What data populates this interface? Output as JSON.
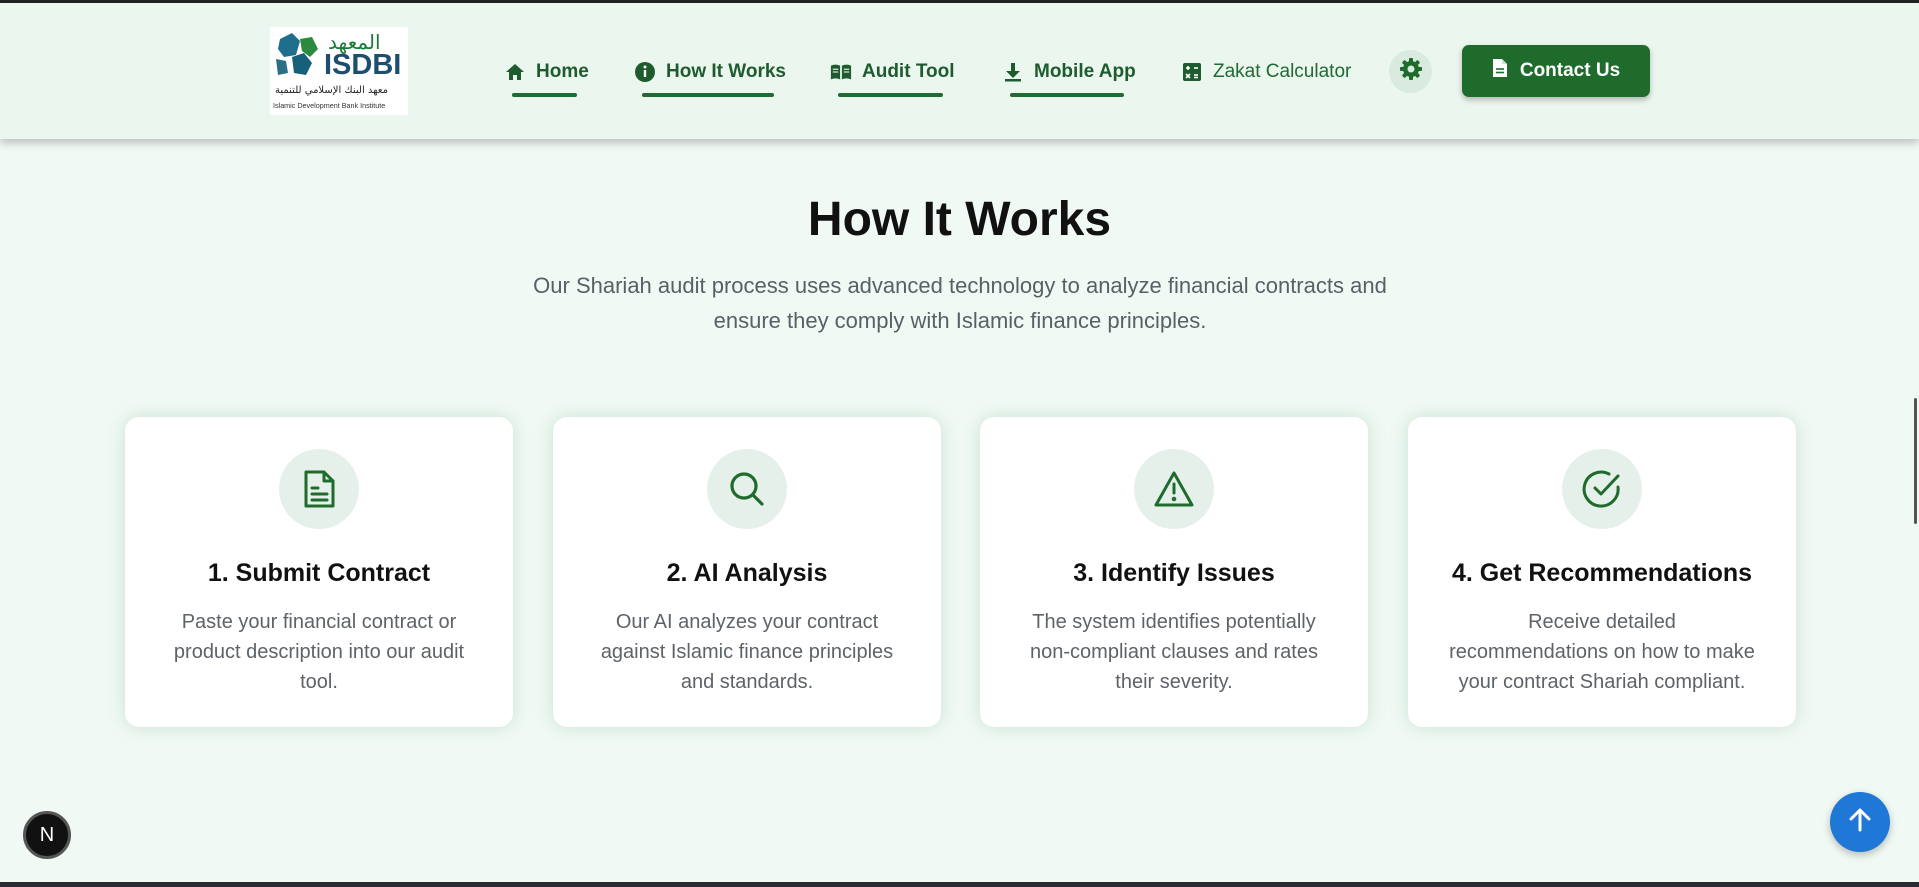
{
  "brand": {
    "arabic_name": "المعهد",
    "short_name": "ISDBI",
    "arabic_full": "معهد البنك الإسلامي للتنمية",
    "english_full": "Islamic Development Bank Institute"
  },
  "nav": {
    "items": [
      {
        "label": "Home",
        "icon": "home-icon",
        "active": true
      },
      {
        "label": "How It Works",
        "icon": "info-icon",
        "active": true
      },
      {
        "label": "Audit Tool",
        "icon": "book-icon",
        "active": true
      },
      {
        "label": "Mobile App",
        "icon": "download-icon",
        "active": true
      },
      {
        "label": "Zakat Calculator",
        "icon": "calculator-icon",
        "active": false
      }
    ],
    "settings_icon": "gear-icon",
    "contact_label": "Contact Us",
    "contact_icon": "document-icon"
  },
  "section": {
    "title": "How It Works",
    "subtitle": "Our Shariah audit process uses advanced technology to analyze financial contracts and ensure they comply with Islamic finance principles."
  },
  "steps": [
    {
      "title": "1. Submit Contract",
      "description": "Paste your financial contract or product description into our audit tool.",
      "icon": "file-text-icon"
    },
    {
      "title": "2. AI Analysis",
      "description": "Our AI analyzes your contract against Islamic finance principles and standards.",
      "icon": "search-icon"
    },
    {
      "title": "3. Identify Issues",
      "description": "The system identifies potentially non-compliant clauses and rates their severity.",
      "icon": "alert-triangle-icon"
    },
    {
      "title": "4. Get Recommendations",
      "description": "Receive detailed recommendations on how to make your contract Shariah compliant.",
      "icon": "check-circle-icon"
    }
  ],
  "colors": {
    "brand_green": "#1e6b2c",
    "header_bg": "#ebf6ee",
    "page_bg": "#f1f9f4",
    "scroll_button": "#1f78d6"
  },
  "floating": {
    "next_badge": "N",
    "scroll_top_icon": "arrow-up-icon"
  }
}
